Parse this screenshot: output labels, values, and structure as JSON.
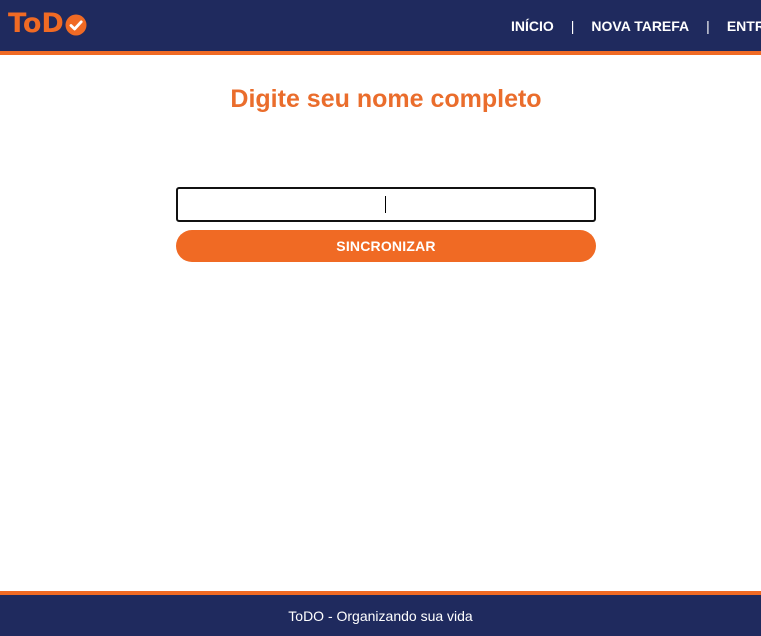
{
  "header": {
    "logo_text": "ToD",
    "logo_icon": "check-circle-icon",
    "nav": [
      {
        "label": "INÍCIO"
      },
      {
        "label": "NOVA TAREFA"
      },
      {
        "label": "ENTRAR"
      }
    ],
    "separator": "|"
  },
  "main": {
    "title": "Digite seu nome completo",
    "name_input": {
      "value": "",
      "placeholder": ""
    },
    "sync_button_label": "SINCRONIZAR"
  },
  "footer": {
    "text": "ToDO - Organizando sua vida"
  },
  "colors": {
    "primary_dark": "#1f2a5e",
    "accent_orange": "#f06a24",
    "title_orange": "#ea6d2c"
  }
}
